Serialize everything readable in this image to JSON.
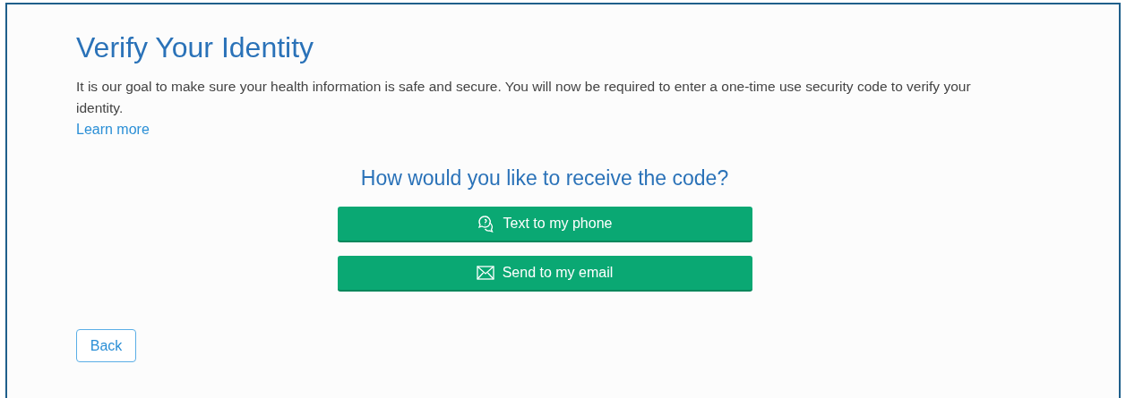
{
  "title": "Verify Your Identity",
  "description": "It is our goal to make sure your health information is safe and secure. You will now be required to enter a one-time use security code to verify your identity.",
  "learn_more": "Learn more",
  "question": "How would you like to receive the code?",
  "options": [
    {
      "kind": "phone",
      "label": "Text to my phone"
    },
    {
      "kind": "email",
      "label": "Send to my email"
    }
  ],
  "back": "Back"
}
